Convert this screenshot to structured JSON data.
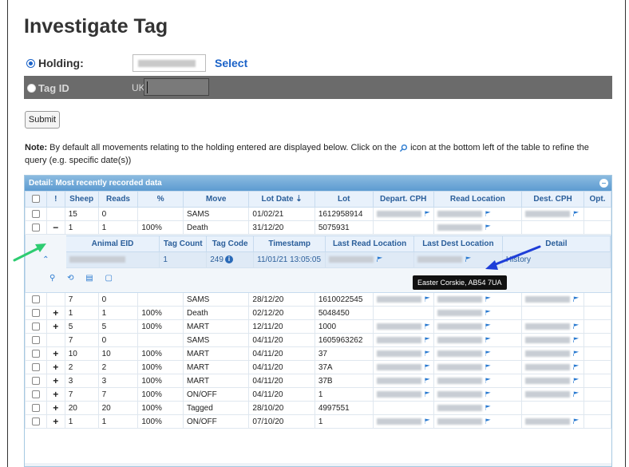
{
  "title": "Investigate Tag",
  "holding": {
    "label": "Holding:",
    "select_label": "Select"
  },
  "tag": {
    "label": "Tag ID",
    "prefix": "UK"
  },
  "submit_label": "Submit",
  "note": {
    "bold": "Note:",
    "text1": "By default all movements relating to the holding entered are displayed below. Click on the",
    "text2": "icon at the bottom left of the table to refine the query (e.g. specific date(s))"
  },
  "grid": {
    "header": "Detail: Most recently recorded data",
    "columns": [
      "",
      "!",
      "Sheep",
      "Reads",
      "%",
      "Move",
      "Lot Date",
      "Lot",
      "Depart. CPH",
      "Read Location",
      "Dest. CPH",
      "Opt."
    ],
    "top_rows": [
      {
        "exp": "",
        "sheep": "15",
        "reads": "0",
        "pct": "",
        "move": "SAMS",
        "date": "01/02/21",
        "lot": "1612958914",
        "dep": true,
        "read": true,
        "dest": true
      },
      {
        "exp": "−",
        "sheep": "1",
        "reads": "1",
        "pct": "100%",
        "move": "Death",
        "date": "31/12/20",
        "lot": "5075931",
        "dep": false,
        "read": true,
        "dest": false
      }
    ],
    "rows": [
      {
        "exp": "",
        "sheep": "7",
        "reads": "0",
        "pct": "",
        "move": "SAMS",
        "date": "28/12/20",
        "lot": "1610022545",
        "dep": true,
        "read": true,
        "dest": true
      },
      {
        "exp": "+",
        "sheep": "1",
        "reads": "1",
        "pct": "100%",
        "move": "Death",
        "date": "02/12/20",
        "lot": "5048450",
        "dep": false,
        "read": true,
        "dest": false
      },
      {
        "exp": "+",
        "sheep": "5",
        "reads": "5",
        "pct": "100%",
        "move": "MART",
        "date": "12/11/20",
        "lot": "1000",
        "dep": true,
        "read": true,
        "dest": true
      },
      {
        "exp": "",
        "sheep": "7",
        "reads": "0",
        "pct": "",
        "move": "SAMS",
        "date": "04/11/20",
        "lot": "1605963262",
        "dep": true,
        "read": true,
        "dest": true
      },
      {
        "exp": "+",
        "sheep": "10",
        "reads": "10",
        "pct": "100%",
        "move": "MART",
        "date": "04/11/20",
        "lot": "37",
        "dep": true,
        "read": true,
        "dest": true
      },
      {
        "exp": "+",
        "sheep": "2",
        "reads": "2",
        "pct": "100%",
        "move": "MART",
        "date": "04/11/20",
        "lot": "37A",
        "dep": true,
        "read": true,
        "dest": true
      },
      {
        "exp": "+",
        "sheep": "3",
        "reads": "3",
        "pct": "100%",
        "move": "MART",
        "date": "04/11/20",
        "lot": "37B",
        "dep": true,
        "read": true,
        "dest": true
      },
      {
        "exp": "+",
        "sheep": "7",
        "reads": "7",
        "pct": "100%",
        "move": "ON/OFF",
        "date": "04/11/20",
        "lot": "1",
        "dep": true,
        "read": true,
        "dest": true
      },
      {
        "exp": "+",
        "sheep": "20",
        "reads": "20",
        "pct": "100%",
        "move": "Tagged",
        "date": "28/10/20",
        "lot": "4997551",
        "dep": false,
        "read": true,
        "dest": false
      },
      {
        "exp": "+",
        "sheep": "1",
        "reads": "1",
        "pct": "100%",
        "move": "ON/OFF",
        "date": "07/10/20",
        "lot": "1",
        "dep": true,
        "read": true,
        "dest": true
      }
    ]
  },
  "sub": {
    "columns": [
      "Animal EID",
      "Tag Count",
      "Tag Code",
      "Timestamp",
      "Last Read Location",
      "Last Dest Location",
      "Detail"
    ],
    "row": {
      "count": "1",
      "code": "249",
      "timestamp": "11/01/21 13:05:05",
      "detail": "History"
    }
  },
  "tooltip": "Easter Corskie, AB54 7UA"
}
